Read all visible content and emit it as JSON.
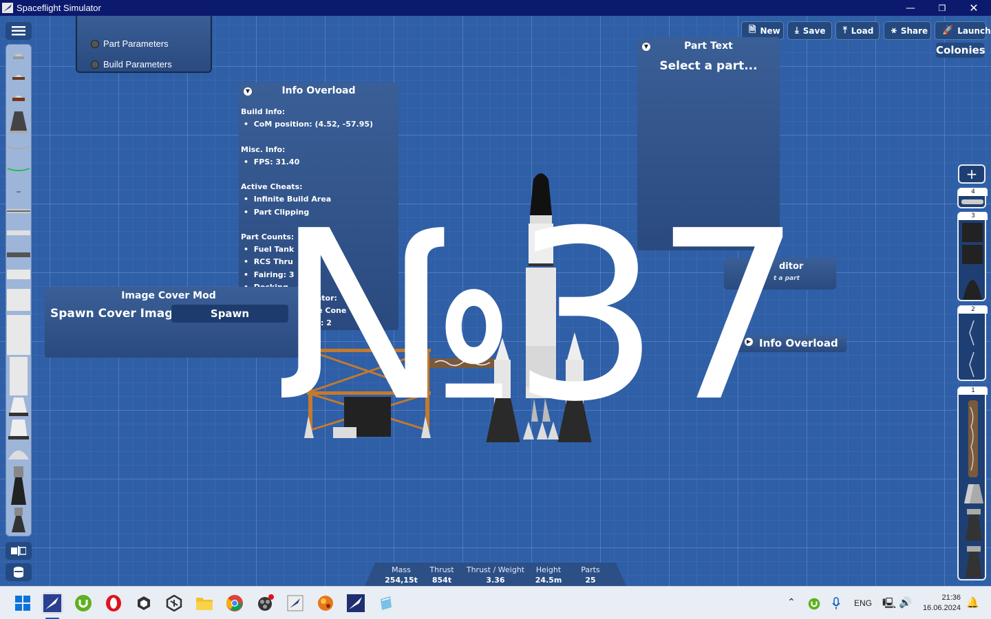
{
  "window": {
    "title": "Spaceflight Simulator"
  },
  "toolbar": {
    "new_label": "New",
    "save_label": "Save",
    "load_label": "Load",
    "share_label": "Share",
    "launch_label": "Launch",
    "colonies_label": "Colonies"
  },
  "settings_menu": {
    "items": [
      "Part Parameters",
      "Build Parameters"
    ]
  },
  "info_panel": {
    "title": "Info Overload",
    "build_info_heading": "Build Info:",
    "com_position": "CoM position: (4.52, -57.95)",
    "misc_heading": "Misc. Info:",
    "fps": "FPS: 31.40",
    "cheats_heading": "Active Cheats:",
    "cheats": [
      "Infinite Build Area",
      "Part Clipping"
    ],
    "counts_heading": "Part Counts:",
    "counts": [
      "Fuel Tank",
      "RCS Thru",
      "Fairing: 3",
      "Docking",
      "Side Tru",
      "ose Cone",
      "ine: 2"
    ],
    "separator_fragment": "arator:",
    "docking_fragment": "2"
  },
  "part_text_panel": {
    "title": "Part Text",
    "body": "Select a part..."
  },
  "editor_panel": {
    "title": "ditor",
    "subtitle": "t a part"
  },
  "info_overload_button": {
    "label": "Info Overload"
  },
  "image_cover_panel": {
    "title": "Image Cover Mod",
    "spawn_text": "Spawn Cover Image",
    "spawn_button": "Spawn"
  },
  "overlay": {
    "text": "№37"
  },
  "stats": {
    "mass_label": "Mass",
    "mass_value": "254,15t",
    "thrust_label": "Thrust",
    "thrust_value": "854t",
    "tw_label": "Thrust / Weight",
    "tw_value": "3.36",
    "height_label": "Height",
    "height_value": "24.5m",
    "parts_label": "Parts",
    "parts_value": "25"
  },
  "stages": [
    "4",
    "3",
    "2",
    "1"
  ],
  "taskbar": {
    "language": "ENG",
    "time": "21:36",
    "date": "16.06.2024"
  },
  "colors": {
    "background": "#2f5fa6",
    "titlebar": "#0c1a6e",
    "panel": "#2a4a7f",
    "taskbar": "#e9edf4"
  }
}
